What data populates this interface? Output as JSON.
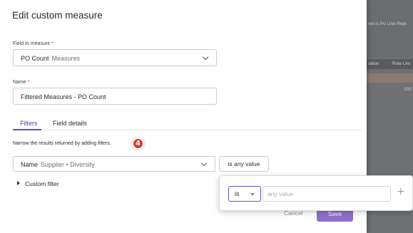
{
  "background": {
    "header_text": "vel is Po Line Reje",
    "tabs": [
      "iation",
      "Row Lim"
    ],
    "number": "200"
  },
  "dialog": {
    "title": "Edit custom measure",
    "field_to_measure": {
      "label": "Field to measure",
      "required_mark": "*",
      "value": "PO Count",
      "sub_value": "Measures"
    },
    "name": {
      "label": "Name",
      "required_mark": "*",
      "value": "Filtered Measures - PO Count"
    },
    "tabs": [
      {
        "label": "Filters",
        "active": true
      },
      {
        "label": "Field details",
        "active": false
      }
    ],
    "filters": {
      "hint": "Narrow the results returned by adding filters.",
      "step_badge": "4",
      "filter_field": {
        "name": "Name",
        "sub": "Supplier • Diversity"
      },
      "condition_pill": "is any value",
      "custom_filter_label": "Custom filter"
    },
    "buttons": {
      "cancel": "Cancel",
      "save": "Save"
    }
  },
  "popover": {
    "operator": "is",
    "value_placeholder": "any value",
    "add_symbol": "+"
  },
  "colors": {
    "accent": "#6b4fb3",
    "save_button": "#8e6ec7",
    "badge": "#d93a2b",
    "required": "#d0342c"
  }
}
